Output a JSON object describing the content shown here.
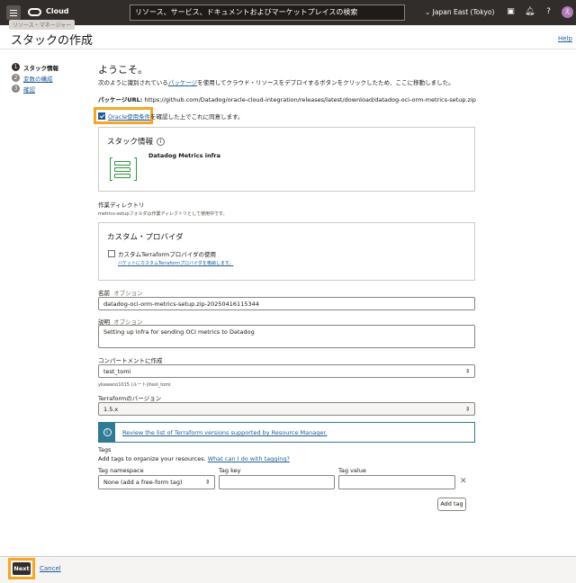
{
  "topbar": {
    "brand": "Cloud",
    "search_placeholder": "リソース、サービス、ドキュメントおよびマーケットプレイスの検索",
    "region": "Japan East (Tokyo)",
    "avatar_initial": "え"
  },
  "breadcrumb_tip": "リソース・マネージャー",
  "page_title": "スタックの作成",
  "help_label": "Help",
  "steps": [
    {
      "num": "1",
      "label": "スタック情報"
    },
    {
      "num": "2",
      "label": "変数の構成"
    },
    {
      "num": "3",
      "label": "確認"
    }
  ],
  "welcome": {
    "heading": "ようこそ。",
    "intro_before": "次のように識別されている",
    "intro_link": "パッケージ",
    "intro_after": "を使用してクラウド・リソースをデプロイするボタンをクリックしたため、ここに移動しました。",
    "package_label": "パッケージURL:",
    "package_url": "https://github.com/Datadog/oracle-cloud-integration/releases/latest/download/datadog-oci-orm-metrics-setup.zip",
    "consent_link": "Oracle使用条件",
    "consent_rest": "を確認した上でこれに同意します。"
  },
  "stack_info": {
    "title": "スタック情報",
    "name": "Datadog Metrics infra"
  },
  "workdir": {
    "label": "作業ディレクトリ",
    "desc": "metrics-setupフォルダは作業ディレクトリとして使用中です。"
  },
  "custom_provider": {
    "title": "カスタム・プロバイダ",
    "checkbox_label": "カスタムTerraformプロバイダの使用",
    "link": "バケットにカスタムTerraformプロバイダを格納します。"
  },
  "form": {
    "name_label": "名前",
    "optional": "オプション",
    "name_value": "datadog-oci-orm-metrics-setup.zip-20250416115344",
    "desc_label": "説明",
    "desc_value": "Setting up infra for sending OCI metrics to Datadog",
    "compartment_label": "コンパートメントに作成",
    "compartment_value": "test_tomi",
    "compartment_path": "ykawano1015 (ルート)/test_tomi",
    "tf_label": "Terraformのバージョン",
    "tf_value": "1.5.x",
    "notice_link": "Review the list of Terraform versions supported by Resource Manager."
  },
  "tags": {
    "heading": "Tags",
    "desc": "Add tags to organize your resources.",
    "help_link": "What can I do with tagging?",
    "ns_label": "Tag namespace",
    "ns_value": "None (add a free-form tag)",
    "key_label": "Tag key",
    "value_label": "Tag value",
    "add_button": "Add tag"
  },
  "footer": {
    "next": "Next",
    "cancel": "Cancel"
  },
  "colors": {
    "topbar": "#312d2a",
    "link": "#1f5c99",
    "highlight": "#f5a623",
    "notice": "#2f7a96"
  }
}
